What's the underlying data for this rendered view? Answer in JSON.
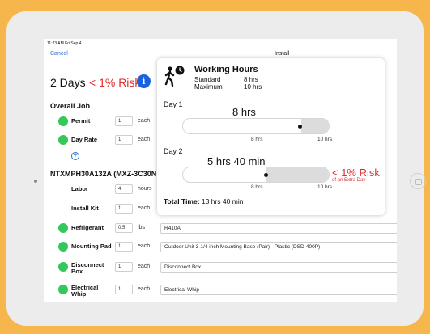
{
  "status_bar": {
    "time": "11:23 AM  Fri Sep 4"
  },
  "nav": {
    "cancel": "Cancel",
    "title": "Install"
  },
  "summary": {
    "days": "2 Days",
    "risk": "< 1% Risk",
    "info_icon": "i"
  },
  "overall_job": {
    "title": "Overall Job",
    "rows": [
      {
        "label": "Permit",
        "qty": "1",
        "unit": "each"
      },
      {
        "label": "Day Rate",
        "qty": "1",
        "unit": "each"
      }
    ]
  },
  "equipment": {
    "title": "NTXMPH30A132A (MXZ-3C30N",
    "rows": [
      {
        "label": "Labor",
        "qty": "4",
        "unit": "hours"
      },
      {
        "label": "Install Kit",
        "qty": "1",
        "unit": "each"
      }
    ]
  },
  "items": [
    {
      "label": "Refrigerant",
      "qty": "0.5",
      "unit": "lbs",
      "desc": "R410A"
    },
    {
      "label": "Mounting Pad",
      "qty": "1",
      "unit": "each",
      "desc": "Outdoor Unit 3-1/4 inch Mounting Base (Pair) - Plastic (DSD-400P)"
    },
    {
      "label": "Disconnect Box",
      "qty": "1",
      "unit": "each",
      "desc": "Disconnect Box"
    },
    {
      "label": "Electrical Whip",
      "qty": "1",
      "unit": "each",
      "desc": "Electrical Whip"
    }
  ],
  "popup": {
    "title": "Working Hours",
    "standard_label": "Standard",
    "standard_value": "8 hrs",
    "maximum_label": "Maximum",
    "maximum_value": "10 hrs",
    "day1": {
      "label": "Day 1",
      "value_text": "8 hrs",
      "hours": 8,
      "tick_standard": "8 hrs",
      "tick_max": "10 hrs"
    },
    "day2": {
      "label": "Day 2",
      "value_text": "5 hrs 40 min",
      "hours": 5.67,
      "tick_standard": "8 hrs",
      "tick_max": "10 hrs",
      "risk": "< 1% Risk",
      "risk_sub": "of an Extra Day"
    },
    "total_label": "Total Time:",
    "total_value": "13 hrs 40 min"
  },
  "colors": {
    "accent": "#2f6fd6",
    "risk": "#e32b2b",
    "ok": "#34c759",
    "info": "#1a63e0",
    "background": "#f6b64b"
  }
}
